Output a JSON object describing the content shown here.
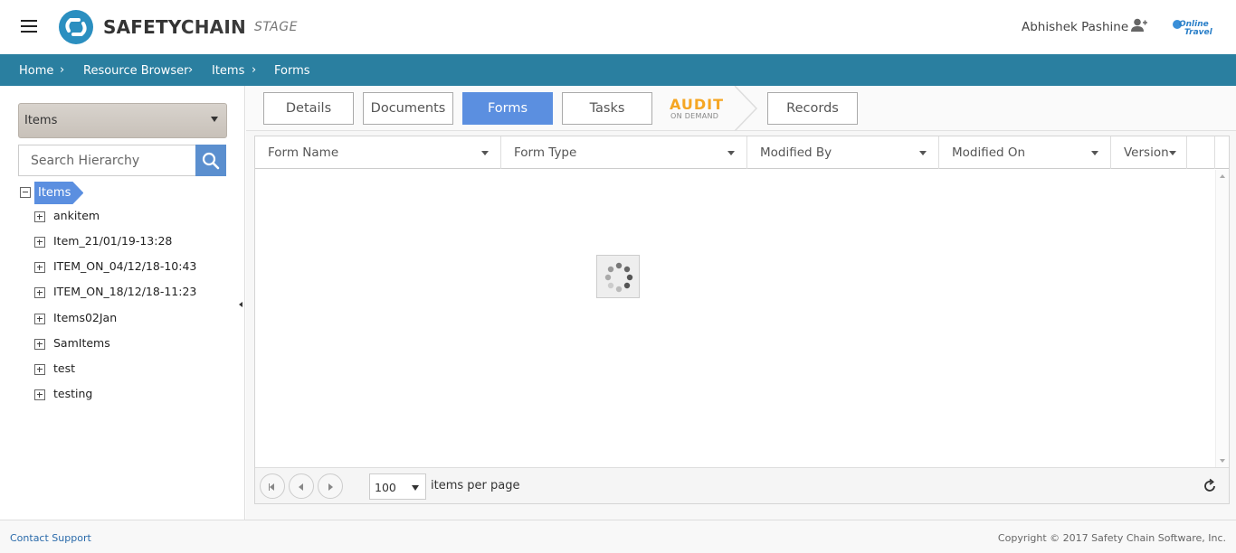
{
  "header": {
    "brand_bold": "SAFETY",
    "brand_rest": "CHAIN",
    "environment": "STAGE",
    "user_name": "Abhishek Pashine",
    "partner_logo_text": "Online Travel"
  },
  "breadcrumb": {
    "items": [
      "Home",
      "Resource Browser",
      "Items",
      "Forms"
    ]
  },
  "sidebar": {
    "hierarchy_select_value": "Items",
    "search_placeholder": "Search Hierarchy",
    "tree_root": "Items",
    "tree_items": [
      "ankitem",
      "Item_21/01/19-13:28",
      "ITEM_ON_04/12/18-10:43",
      "ITEM_ON_18/12/18-11:23",
      "Items02Jan",
      "SamItems",
      "test",
      "testing"
    ]
  },
  "tabs": {
    "items": [
      "Details",
      "Documents",
      "Forms",
      "Tasks",
      "Records"
    ],
    "active": "Forms",
    "audit_title": "AUDIT",
    "audit_subtitle": "ON DEMAND"
  },
  "grid": {
    "columns": [
      "Form Name",
      "Form Type",
      "Modified By",
      "Modified On",
      "Version"
    ],
    "rows": [],
    "loading": true
  },
  "pager": {
    "page_size": "100",
    "page_size_label": "items per page"
  },
  "footer": {
    "contact": "Contact Support",
    "copyright": "Copyright © 2017 Safety Chain Software, Inc."
  },
  "colors": {
    "breadcrumb_bar": "#2a7fa0",
    "accent": "#5b8fe0",
    "audit_orange": "#f5a623"
  }
}
